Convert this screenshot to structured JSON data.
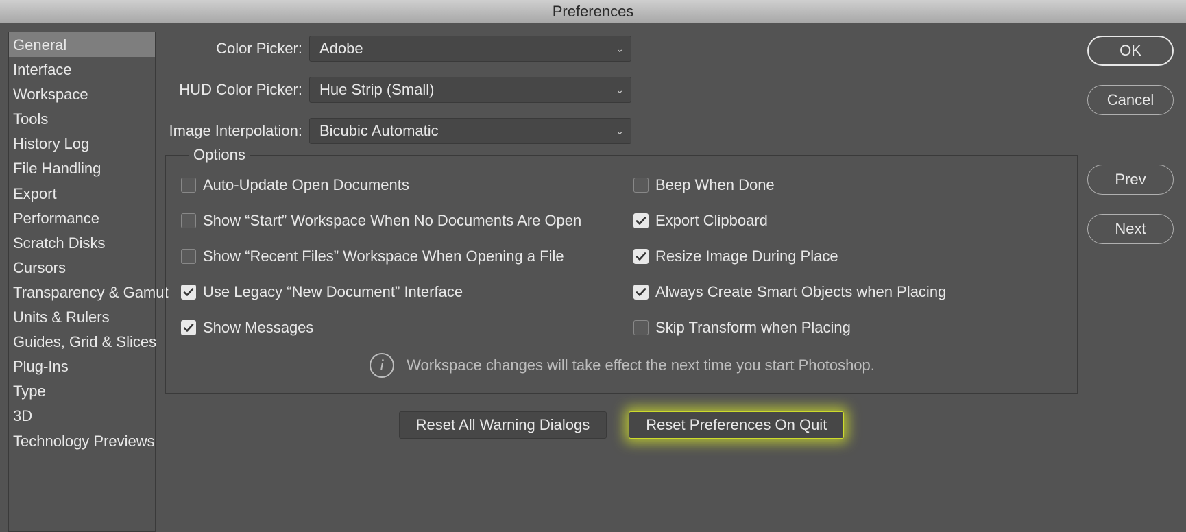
{
  "window": {
    "title": "Preferences"
  },
  "sidebar": {
    "items": [
      {
        "label": "General",
        "selected": true
      },
      {
        "label": "Interface"
      },
      {
        "label": "Workspace"
      },
      {
        "label": "Tools"
      },
      {
        "label": "History Log"
      },
      {
        "label": "File Handling"
      },
      {
        "label": "Export"
      },
      {
        "label": "Performance"
      },
      {
        "label": "Scratch Disks"
      },
      {
        "label": "Cursors"
      },
      {
        "label": "Transparency & Gamut"
      },
      {
        "label": "Units & Rulers"
      },
      {
        "label": "Guides, Grid & Slices"
      },
      {
        "label": "Plug-Ins"
      },
      {
        "label": "Type"
      },
      {
        "label": "3D"
      },
      {
        "label": "Technology Previews"
      }
    ]
  },
  "form": {
    "color_picker": {
      "label": "Color Picker:",
      "value": "Adobe"
    },
    "hud_color_picker": {
      "label": "HUD Color Picker:",
      "value": "Hue Strip (Small)"
    },
    "image_interpolation": {
      "label": "Image Interpolation:",
      "value": "Bicubic Automatic"
    }
  },
  "options": {
    "legend": "Options",
    "left": [
      {
        "label": "Auto-Update Open Documents",
        "checked": false
      },
      {
        "label": "Show “Start” Workspace When No Documents Are Open",
        "checked": false
      },
      {
        "label": "Show “Recent Files” Workspace When Opening a File",
        "checked": false
      },
      {
        "label": "Use Legacy “New Document” Interface",
        "checked": true
      },
      {
        "label": "Show Messages",
        "checked": true
      }
    ],
    "right": [
      {
        "label": "Beep When Done",
        "checked": false
      },
      {
        "label": "Export Clipboard",
        "checked": true
      },
      {
        "label": "Resize Image During Place",
        "checked": true
      },
      {
        "label": "Always Create Smart Objects when Placing",
        "checked": true
      },
      {
        "label": "Skip Transform when Placing",
        "checked": false
      }
    ],
    "info": "Workspace changes will take effect the next time you start Photoshop."
  },
  "bottom_buttons": {
    "reset_warnings": "Reset All Warning Dialogs",
    "reset_prefs": "Reset Preferences On Quit"
  },
  "right_buttons": {
    "ok": "OK",
    "cancel": "Cancel",
    "prev": "Prev",
    "next": "Next"
  }
}
